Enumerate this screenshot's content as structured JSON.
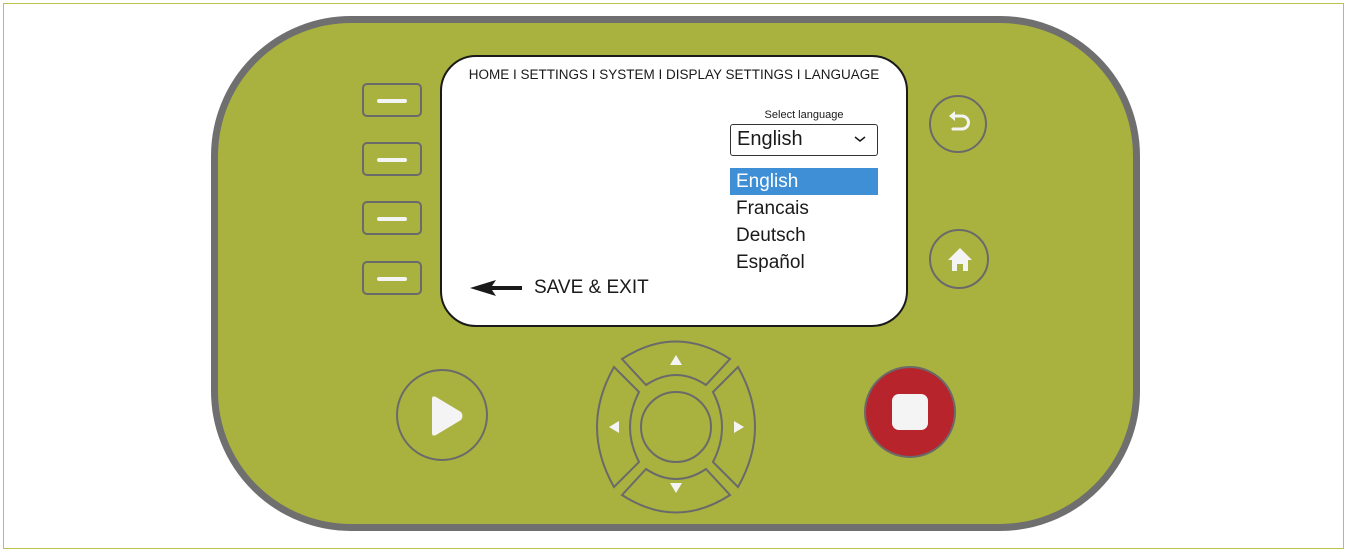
{
  "screen": {
    "breadcrumb": "HOME I SETTINGS I SYSTEM I DISPLAY SETTINGS I LANGUAGE",
    "select_label": "Select language",
    "selected_value": "English",
    "options": [
      "English",
      "Francais",
      "Deutsch",
      "Español"
    ],
    "highlighted_option": "English",
    "save_exit_label": "SAVE & EXIT"
  },
  "soft_keys": [
    "soft-key-1",
    "soft-key-2",
    "soft-key-3",
    "soft-key-4"
  ],
  "buttons": [
    "back",
    "home",
    "play",
    "stop",
    "dpad-up",
    "dpad-down",
    "dpad-left",
    "dpad-right",
    "dpad-center"
  ],
  "icons": [
    "back-arrow-icon",
    "home-icon",
    "play-icon",
    "stop-icon",
    "arrow-left-icon",
    "chevron-down-icon"
  ],
  "colors": {
    "device_body": "#a9b13f",
    "device_border": "#6f6f6f",
    "stop_button": "#b7242c",
    "highlight": "#3e8fd6",
    "screen_background": "#ffffff"
  }
}
